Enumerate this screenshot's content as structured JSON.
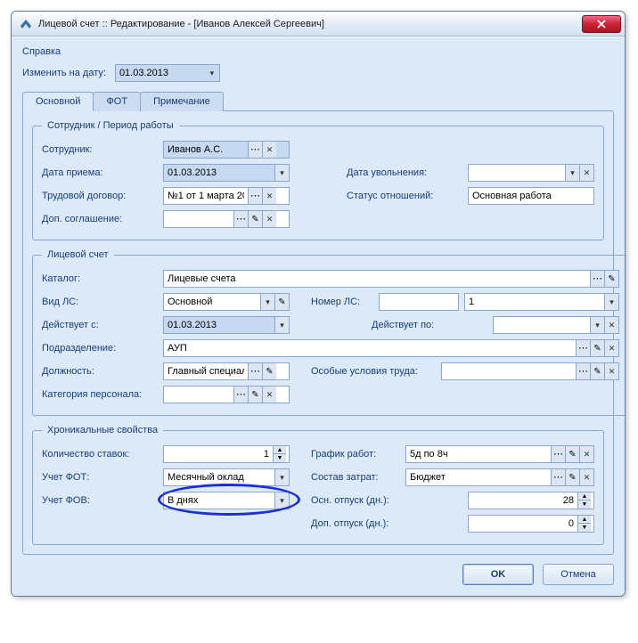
{
  "window": {
    "title": "Лицевой счет :: Редактирование - [Иванов Алексей Сергеевич]"
  },
  "menu": {
    "help": "Справка"
  },
  "changeDate": {
    "label": "Изменить на дату:",
    "value": "01.03.2013"
  },
  "tabs": {
    "main": "Основной",
    "fot": "ФОТ",
    "note": "Примечание"
  },
  "grp1": {
    "legend": "Сотрудник / Период работы",
    "employee_lbl": "Сотрудник:",
    "employee_val": "Иванов А.С.",
    "hire_lbl": "Дата приема:",
    "hire_val": "01.03.2013",
    "fire_lbl": "Дата увольнения:",
    "fire_val": "",
    "contract_lbl": "Трудовой договор:",
    "contract_val": "№1 от 1 марта 20…",
    "status_lbl": "Статус отношений:",
    "status_val": "Основная работа",
    "addagr_lbl": "Доп. соглашение:",
    "addagr_val": ""
  },
  "grp2": {
    "legend": "Лицевой счет",
    "catalog_lbl": "Каталог:",
    "catalog_val": "Лицевые счета",
    "type_lbl": "Вид ЛС:",
    "type_val": "Основной",
    "num_lbl": "Номер ЛС:",
    "num_val": "",
    "num_val2": "1",
    "from_lbl": "Действует с:",
    "from_val": "01.03.2013",
    "to_lbl": "Действует по:",
    "to_val": "",
    "dept_lbl": "Подразделение:",
    "dept_val": "АУП",
    "pos_lbl": "Должность:",
    "pos_val": "Главный специал…",
    "cond_lbl": "Особые условия труда:",
    "cond_val": "",
    "cat_lbl": "Категория персонала:",
    "cat_val": ""
  },
  "grp3": {
    "legend": "Хроникальные свойства",
    "rates_lbl": "Количество ставок:",
    "rates_val": "1",
    "sched_lbl": "График работ:",
    "sched_val": "5д по 8ч",
    "fot_lbl": "Учет ФОТ:",
    "fot_val": "Месячный оклад",
    "cost_lbl": "Состав затрат:",
    "cost_val": "Бюджет",
    "fov_lbl": "Учет ФОВ:",
    "fov_val": "В днях",
    "vac_lbl": "Осн. отпуск (дн.):",
    "vac_val": "28",
    "addvac_lbl": "Доп. отпуск (дн.):",
    "addvac_val": "0"
  },
  "buttons": {
    "ok": "OK",
    "cancel": "Отмена"
  }
}
